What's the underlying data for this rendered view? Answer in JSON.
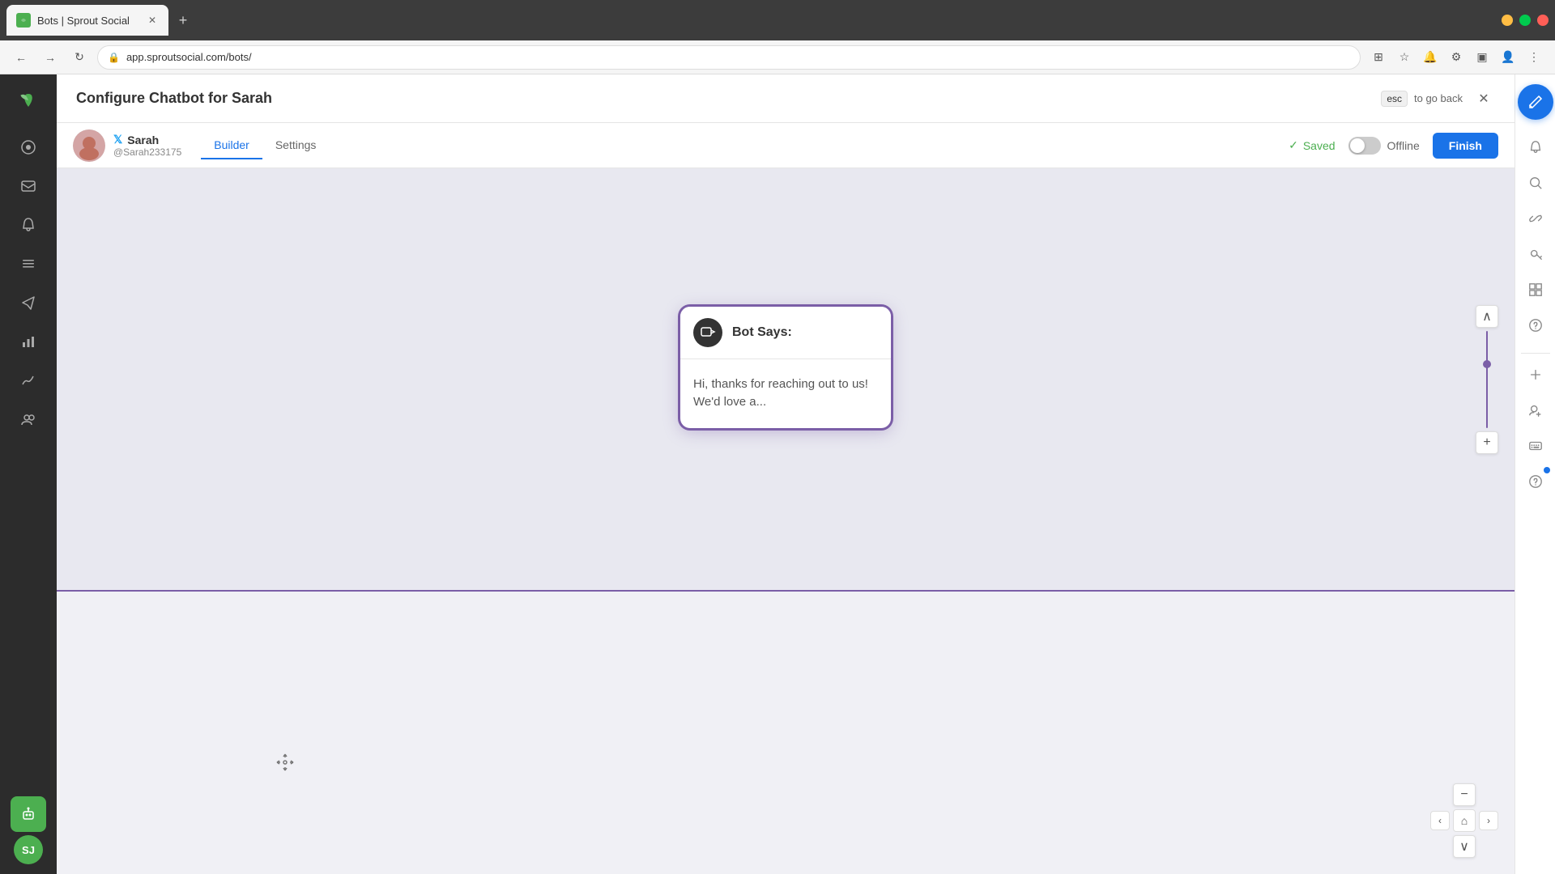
{
  "browser": {
    "tab_title": "Bots | Sprout Social",
    "url": "app.sproutsocial.com/bots/",
    "new_tab_label": "+"
  },
  "header": {
    "title": "Configure Chatbot for Sarah",
    "esc_label": "esc",
    "esc_hint": "to go back"
  },
  "bot_toolbar": {
    "bot_name": "Sarah",
    "bot_handle": "@Sarah233175",
    "tab_builder": "Builder",
    "tab_settings": "Settings",
    "saved_label": "Saved",
    "offline_label": "Offline",
    "finish_label": "Finish"
  },
  "bot_node": {
    "header_title": "Bot Says:",
    "body_text": "Hi, thanks for reaching out to us! We'd love a..."
  },
  "left_sidebar": {
    "items": [
      {
        "id": "dashboard",
        "icon": "⊙",
        "label": "Dashboard"
      },
      {
        "id": "inbox",
        "icon": "✉",
        "label": "Inbox"
      },
      {
        "id": "notifications",
        "icon": "🔔",
        "label": "Notifications"
      },
      {
        "id": "tasks",
        "icon": "≡",
        "label": "Tasks"
      },
      {
        "id": "send",
        "icon": "✈",
        "label": "Publishing"
      },
      {
        "id": "analytics",
        "icon": "📊",
        "label": "Analytics"
      },
      {
        "id": "reports",
        "icon": "📈",
        "label": "Reports"
      },
      {
        "id": "groups",
        "icon": "👥",
        "label": "Groups"
      }
    ],
    "bot_active": {
      "icon": "🤖",
      "label": "Bots"
    },
    "avatar_initials": "SJ"
  },
  "right_sidebar": {
    "items": [
      {
        "id": "compose",
        "icon": "✏",
        "label": "Compose"
      },
      {
        "id": "notifications",
        "icon": "🔔",
        "label": "Notifications"
      },
      {
        "id": "search",
        "icon": "⊙",
        "label": "Search"
      },
      {
        "id": "link",
        "icon": "🔗",
        "label": "Link"
      },
      {
        "id": "key",
        "icon": "🔑",
        "label": "Key"
      },
      {
        "id": "grid",
        "icon": "⊞",
        "label": "Grid"
      },
      {
        "id": "help",
        "icon": "?",
        "label": "Help"
      },
      {
        "id": "add",
        "icon": "+",
        "label": "Add"
      },
      {
        "id": "user-add",
        "icon": "👤",
        "label": "Add User"
      },
      {
        "id": "keyboard",
        "icon": "⌨",
        "label": "Keyboard"
      },
      {
        "id": "help2",
        "icon": "?",
        "label": "Help"
      }
    ]
  },
  "zoom_controls": {
    "plus_label": "+",
    "minus_label": "−",
    "home_label": "⌂",
    "prev_label": "‹",
    "next_label": "›",
    "up_label": "∧",
    "down_label": "∨"
  }
}
